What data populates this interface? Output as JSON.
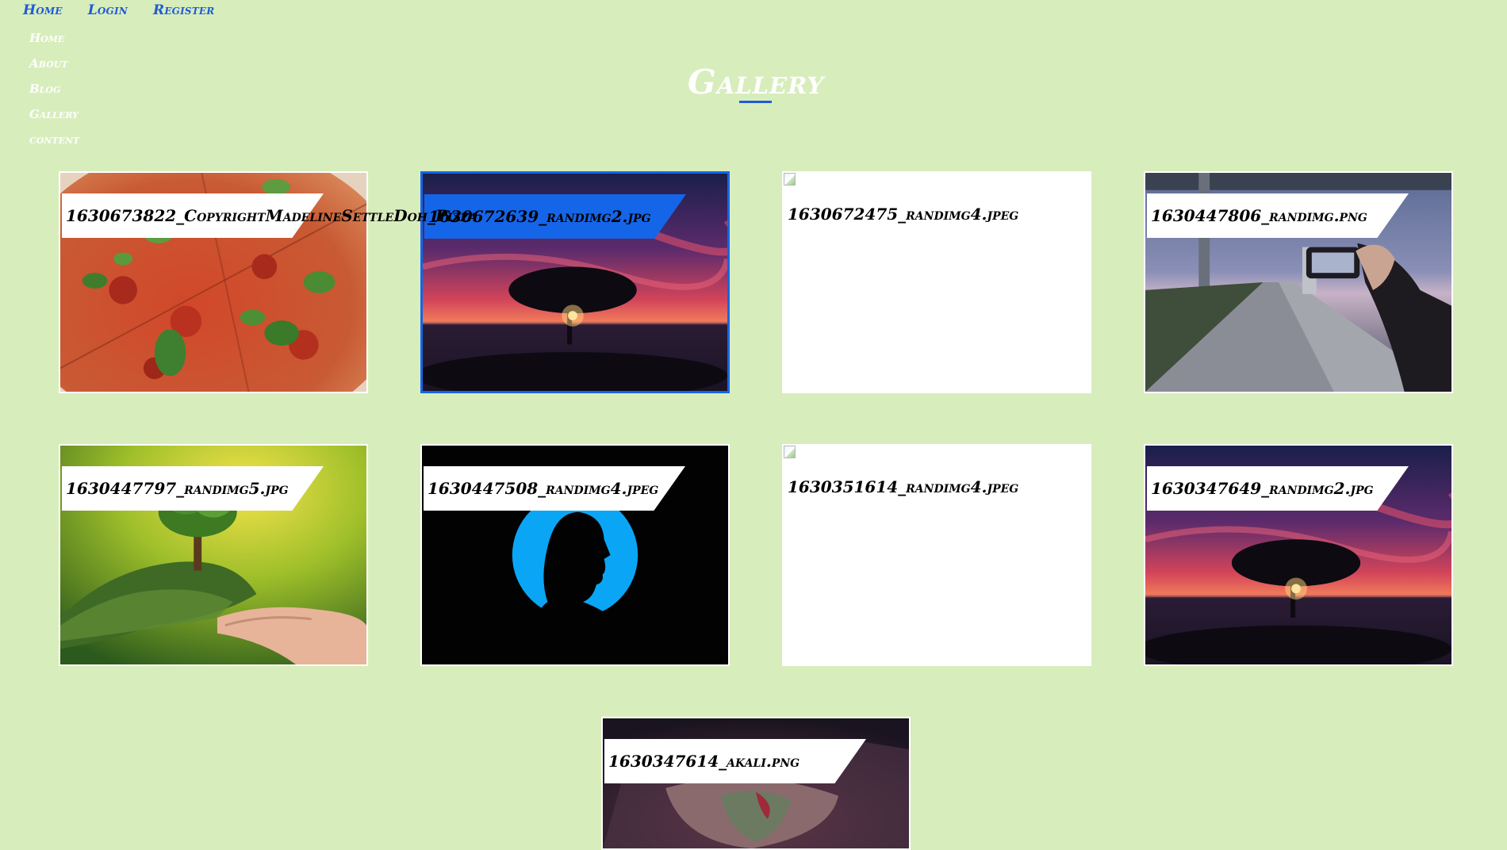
{
  "topnav": {
    "items": [
      {
        "label": "Home"
      },
      {
        "label": "Login"
      },
      {
        "label": "Register"
      }
    ]
  },
  "sidenav": {
    "items": [
      {
        "label": "Home"
      },
      {
        "label": "About"
      },
      {
        "label": "Blog"
      },
      {
        "label": "Gallery"
      },
      {
        "label": "content"
      }
    ]
  },
  "title": "Gallery",
  "colors": {
    "background": "#d8edbc",
    "accent": "#1565e8",
    "nav_link": "#1e5bd7"
  },
  "gallery": {
    "items": [
      {
        "caption": "1630673822_CopyrightMadelineSettleDoh_Pizza",
        "image": "pizza with basil"
      },
      {
        "caption": "1630672639_randimg2.jpg",
        "image": "tree at sunset by the sea"
      },
      {
        "caption": "1630672475_randimg4.jpeg",
        "image": "broken image"
      },
      {
        "caption": "1630447806_randimg.png",
        "image": "phone camera photographing an empty road"
      },
      {
        "caption": "1630447797_randimg5.jpg",
        "image": "hands holding a tree"
      },
      {
        "caption": "1630447508_randimg4.jpeg",
        "image": "silhouette profile on blue circle"
      },
      {
        "caption": "1630351614_randimg4.jpeg",
        "image": "broken image"
      },
      {
        "caption": "1630347649_randimg2.jpg",
        "image": "tree at sunset by the sea"
      },
      {
        "caption": "1630347614_akali.png",
        "image": "masked character artwork"
      }
    ]
  }
}
